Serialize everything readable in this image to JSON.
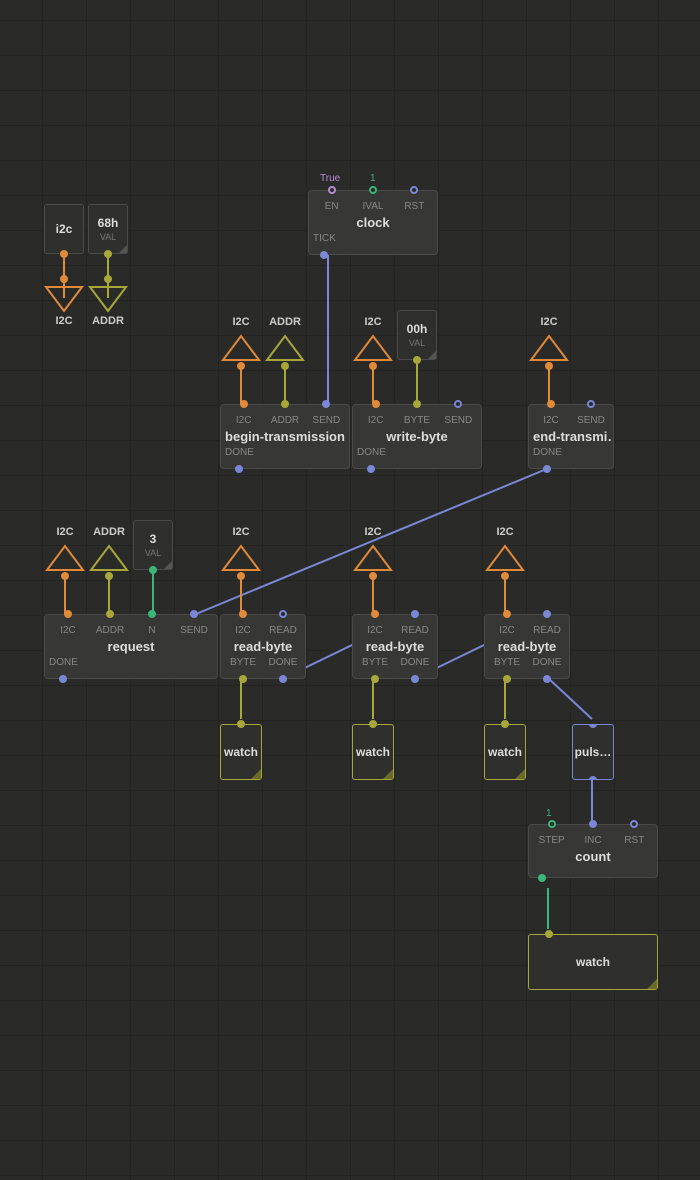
{
  "chips": {
    "i2c": {
      "label": "i2c"
    },
    "addr68": {
      "label": "68h",
      "sub": "VAL"
    },
    "byte00": {
      "label": "00h",
      "sub": "VAL"
    },
    "n3": {
      "label": "3",
      "sub": "VAL"
    }
  },
  "tris": {
    "i2c_out": "I2C",
    "addr_out": "ADDR",
    "bt_i2c": "I2C",
    "bt_addr": "ADDR",
    "wb_i2c": "I2C",
    "et_i2c": "I2C",
    "rq_i2c": "I2C",
    "rq_addr": "ADDR",
    "rb1_i2c": "I2C",
    "rb2_i2c": "I2C",
    "rb3_i2c": "I2C"
  },
  "nodes": {
    "clock": {
      "title": "clock",
      "in": [
        "EN",
        "IVAL",
        "RST"
      ],
      "out": [
        "TICK"
      ],
      "vals": {
        "EN": "True",
        "IVAL": "1"
      }
    },
    "bt": {
      "title": "begin-transmission",
      "in": [
        "I2C",
        "ADDR",
        "SEND"
      ],
      "out": [
        "DONE"
      ]
    },
    "wb": {
      "title": "write-byte",
      "in": [
        "I2C",
        "BYTE",
        "SEND"
      ],
      "out": [
        "DONE"
      ]
    },
    "et": {
      "title": "end-transmi…",
      "in": [
        "I2C",
        "SEND"
      ],
      "out": [
        "DONE"
      ]
    },
    "rq": {
      "title": "request",
      "in": [
        "I2C",
        "ADDR",
        "N",
        "SEND"
      ],
      "out": [
        "DONE"
      ]
    },
    "rb1": {
      "title": "read-byte",
      "in": [
        "I2C",
        "READ"
      ],
      "out": [
        "BYTE",
        "DONE"
      ]
    },
    "rb2": {
      "title": "read-byte",
      "in": [
        "I2C",
        "READ"
      ],
      "out": [
        "BYTE",
        "DONE"
      ]
    },
    "rb3": {
      "title": "read-byte",
      "in": [
        "I2C",
        "READ"
      ],
      "out": [
        "BYTE",
        "DONE"
      ]
    },
    "count": {
      "title": "count",
      "in": [
        "STEP",
        "INC",
        "RST"
      ],
      "out": [
        ""
      ],
      "vals": {
        "STEP": "1"
      }
    }
  },
  "watch": "watch",
  "pulse": "puls…"
}
